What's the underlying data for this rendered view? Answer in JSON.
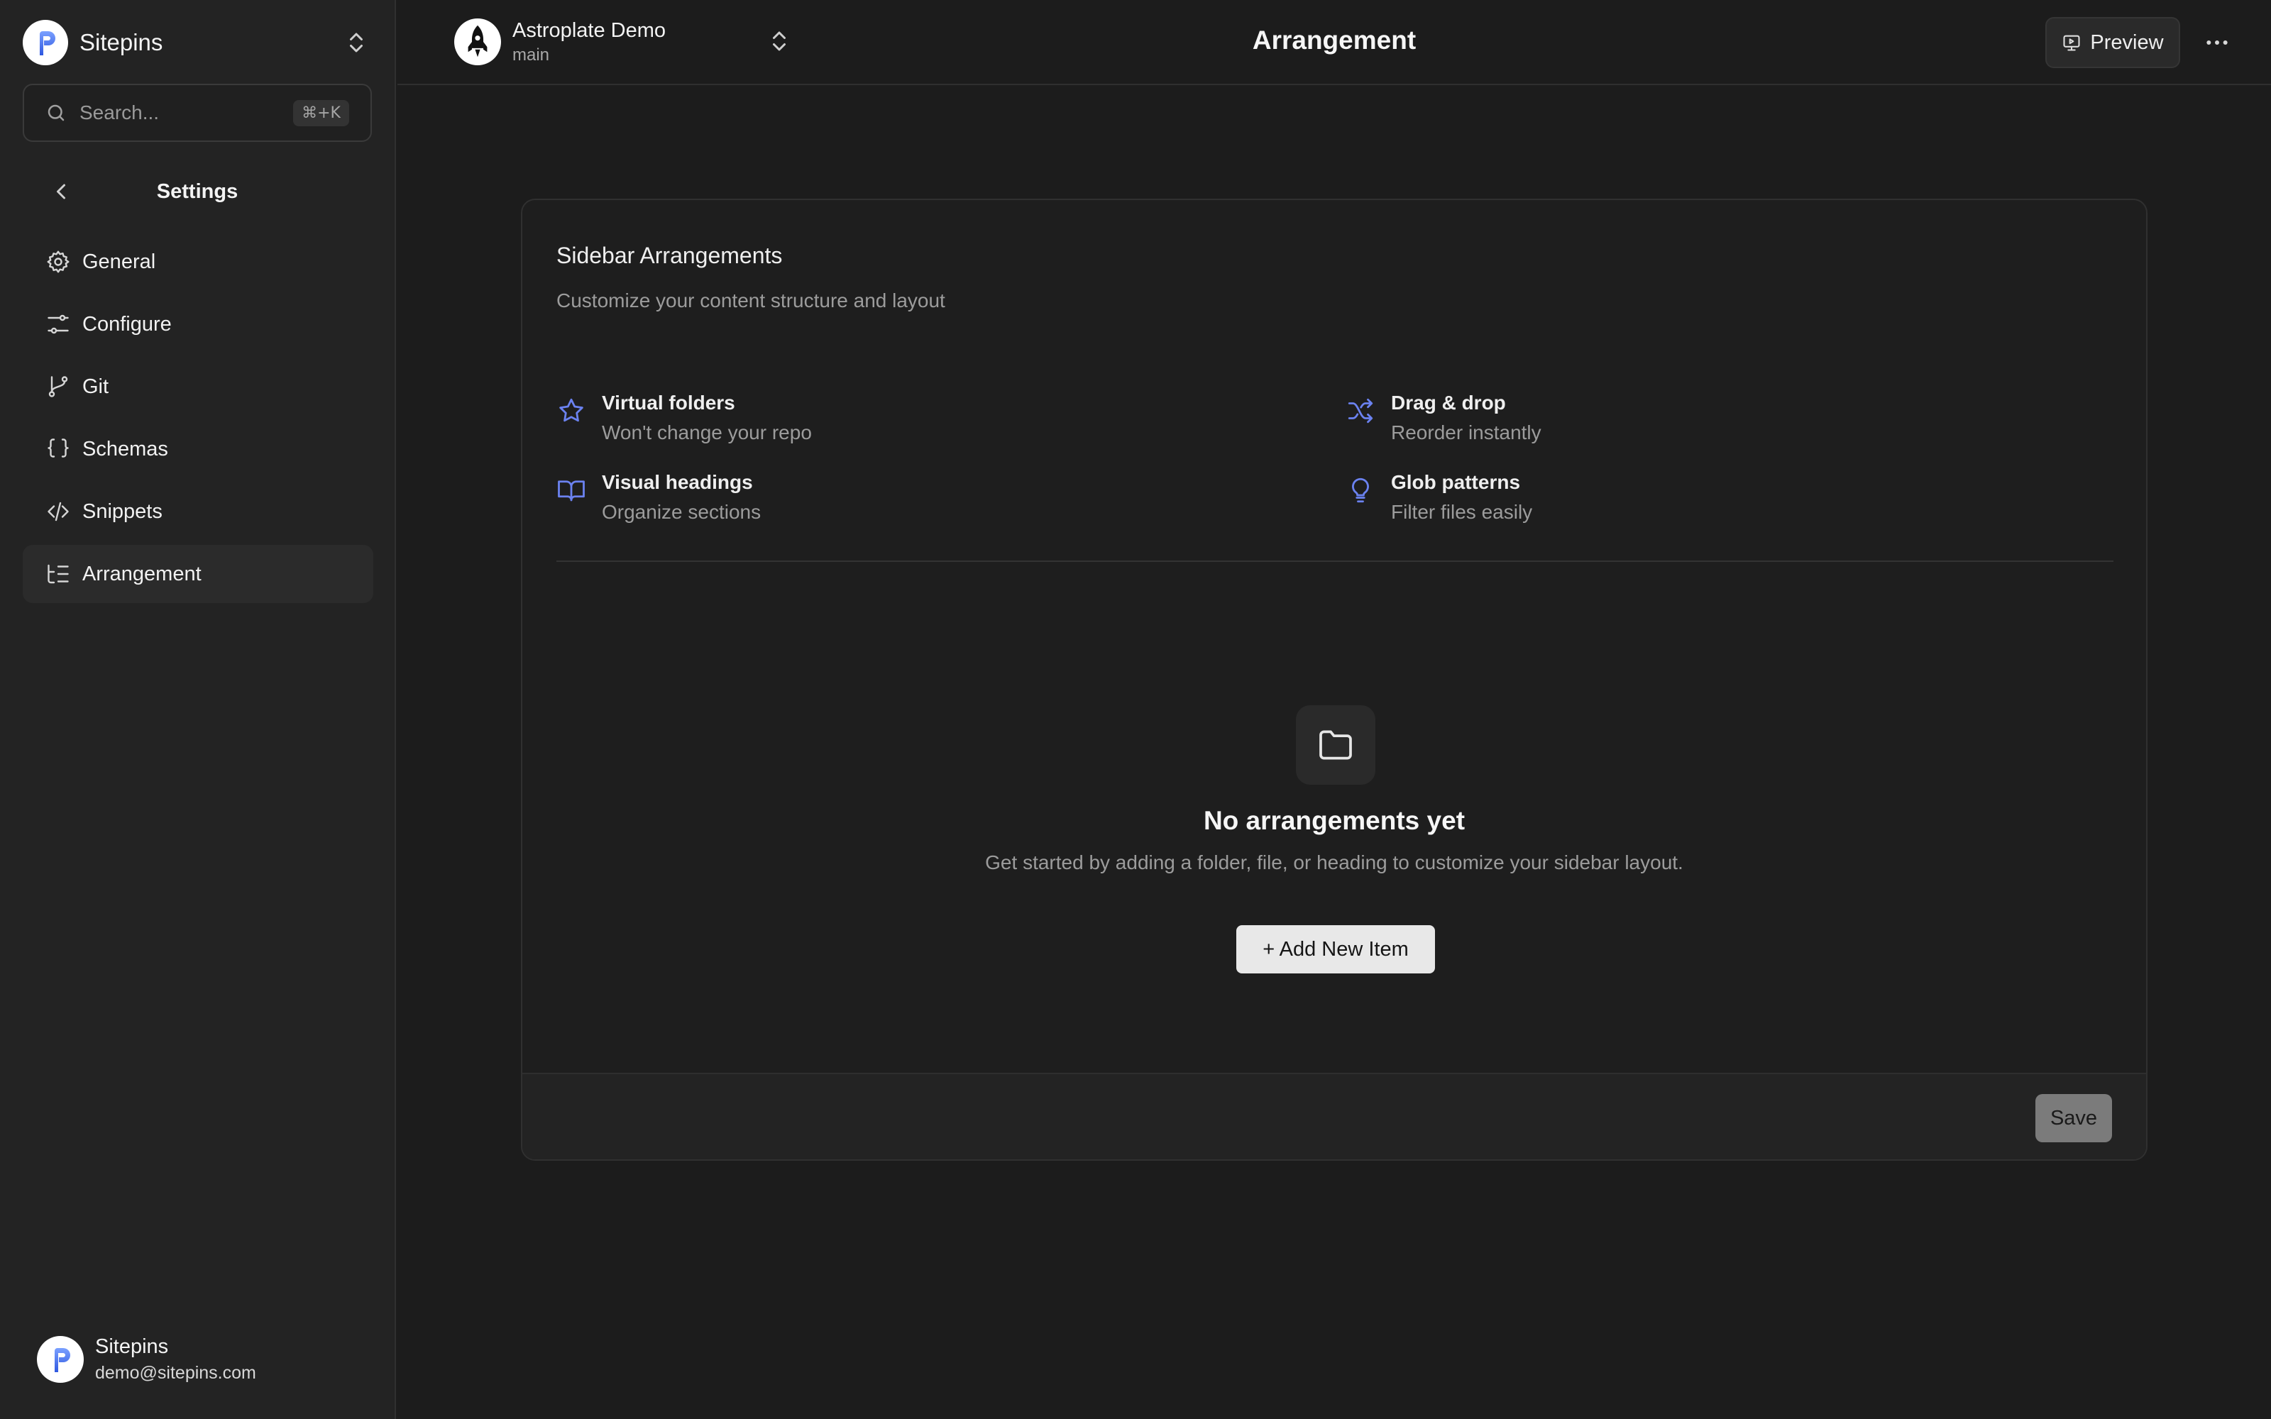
{
  "sidebar": {
    "brand_name": "Sitepins",
    "search_placeholder": "Search...",
    "search_shortcut": "⌘+K",
    "section_title": "Settings",
    "items": [
      {
        "label": "General",
        "icon": "gear-icon"
      },
      {
        "label": "Configure",
        "icon": "sliders-icon"
      },
      {
        "label": "Git",
        "icon": "git-branch-icon"
      },
      {
        "label": "Schemas",
        "icon": "braces-icon"
      },
      {
        "label": "Snippets",
        "icon": "code-icon"
      },
      {
        "label": "Arrangement",
        "icon": "list-tree-icon",
        "active": true
      }
    ],
    "user": {
      "name": "Sitepins",
      "email": "demo@sitepins.com"
    }
  },
  "topbar": {
    "project_name": "Astroplate Demo",
    "branch": "main",
    "page_title": "Arrangement",
    "preview_label": "Preview"
  },
  "card": {
    "title": "Sidebar Arrangements",
    "subtitle": "Customize your content structure and layout",
    "features": [
      {
        "title": "Virtual folders",
        "desc": "Won't change your repo",
        "icon": "star-icon"
      },
      {
        "title": "Drag & drop",
        "desc": "Reorder instantly",
        "icon": "shuffle-icon"
      },
      {
        "title": "Visual headings",
        "desc": "Organize sections",
        "icon": "book-open-icon"
      },
      {
        "title": "Glob patterns",
        "desc": "Filter files easily",
        "icon": "lightbulb-icon"
      }
    ],
    "empty_title": "No arrangements yet",
    "empty_desc": "Get started by adding a folder, file, or heading to customize your sidebar layout.",
    "add_label": "+ Add New Item",
    "save_label": "Save"
  },
  "colors": {
    "background": "#1c1c1c",
    "sidebar": "#232323",
    "accent_icon": "#6b82f0",
    "brand_blue": "#3f6df0"
  }
}
